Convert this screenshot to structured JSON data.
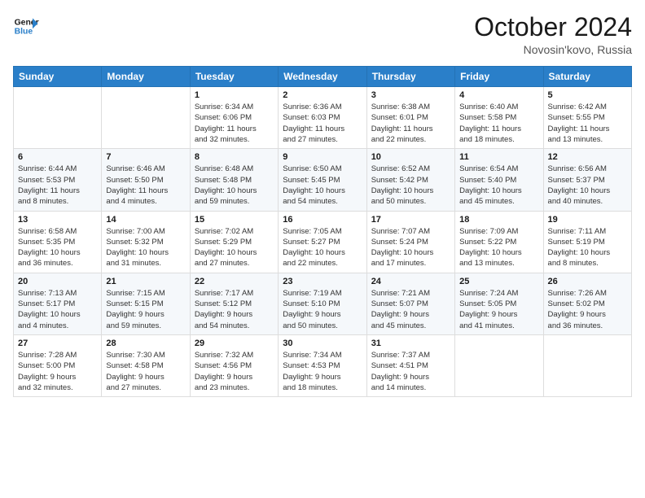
{
  "header": {
    "logo_line1": "General",
    "logo_line2": "Blue",
    "month": "October 2024",
    "location": "Novosin'kovo, Russia"
  },
  "weekdays": [
    "Sunday",
    "Monday",
    "Tuesday",
    "Wednesday",
    "Thursday",
    "Friday",
    "Saturday"
  ],
  "weeks": [
    [
      {
        "day": "",
        "info": ""
      },
      {
        "day": "",
        "info": ""
      },
      {
        "day": "1",
        "info": "Sunrise: 6:34 AM\nSunset: 6:06 PM\nDaylight: 11 hours\nand 32 minutes."
      },
      {
        "day": "2",
        "info": "Sunrise: 6:36 AM\nSunset: 6:03 PM\nDaylight: 11 hours\nand 27 minutes."
      },
      {
        "day": "3",
        "info": "Sunrise: 6:38 AM\nSunset: 6:01 PM\nDaylight: 11 hours\nand 22 minutes."
      },
      {
        "day": "4",
        "info": "Sunrise: 6:40 AM\nSunset: 5:58 PM\nDaylight: 11 hours\nand 18 minutes."
      },
      {
        "day": "5",
        "info": "Sunrise: 6:42 AM\nSunset: 5:55 PM\nDaylight: 11 hours\nand 13 minutes."
      }
    ],
    [
      {
        "day": "6",
        "info": "Sunrise: 6:44 AM\nSunset: 5:53 PM\nDaylight: 11 hours\nand 8 minutes."
      },
      {
        "day": "7",
        "info": "Sunrise: 6:46 AM\nSunset: 5:50 PM\nDaylight: 11 hours\nand 4 minutes."
      },
      {
        "day": "8",
        "info": "Sunrise: 6:48 AM\nSunset: 5:48 PM\nDaylight: 10 hours\nand 59 minutes."
      },
      {
        "day": "9",
        "info": "Sunrise: 6:50 AM\nSunset: 5:45 PM\nDaylight: 10 hours\nand 54 minutes."
      },
      {
        "day": "10",
        "info": "Sunrise: 6:52 AM\nSunset: 5:42 PM\nDaylight: 10 hours\nand 50 minutes."
      },
      {
        "day": "11",
        "info": "Sunrise: 6:54 AM\nSunset: 5:40 PM\nDaylight: 10 hours\nand 45 minutes."
      },
      {
        "day": "12",
        "info": "Sunrise: 6:56 AM\nSunset: 5:37 PM\nDaylight: 10 hours\nand 40 minutes."
      }
    ],
    [
      {
        "day": "13",
        "info": "Sunrise: 6:58 AM\nSunset: 5:35 PM\nDaylight: 10 hours\nand 36 minutes."
      },
      {
        "day": "14",
        "info": "Sunrise: 7:00 AM\nSunset: 5:32 PM\nDaylight: 10 hours\nand 31 minutes."
      },
      {
        "day": "15",
        "info": "Sunrise: 7:02 AM\nSunset: 5:29 PM\nDaylight: 10 hours\nand 27 minutes."
      },
      {
        "day": "16",
        "info": "Sunrise: 7:05 AM\nSunset: 5:27 PM\nDaylight: 10 hours\nand 22 minutes."
      },
      {
        "day": "17",
        "info": "Sunrise: 7:07 AM\nSunset: 5:24 PM\nDaylight: 10 hours\nand 17 minutes."
      },
      {
        "day": "18",
        "info": "Sunrise: 7:09 AM\nSunset: 5:22 PM\nDaylight: 10 hours\nand 13 minutes."
      },
      {
        "day": "19",
        "info": "Sunrise: 7:11 AM\nSunset: 5:19 PM\nDaylight: 10 hours\nand 8 minutes."
      }
    ],
    [
      {
        "day": "20",
        "info": "Sunrise: 7:13 AM\nSunset: 5:17 PM\nDaylight: 10 hours\nand 4 minutes."
      },
      {
        "day": "21",
        "info": "Sunrise: 7:15 AM\nSunset: 5:15 PM\nDaylight: 9 hours\nand 59 minutes."
      },
      {
        "day": "22",
        "info": "Sunrise: 7:17 AM\nSunset: 5:12 PM\nDaylight: 9 hours\nand 54 minutes."
      },
      {
        "day": "23",
        "info": "Sunrise: 7:19 AM\nSunset: 5:10 PM\nDaylight: 9 hours\nand 50 minutes."
      },
      {
        "day": "24",
        "info": "Sunrise: 7:21 AM\nSunset: 5:07 PM\nDaylight: 9 hours\nand 45 minutes."
      },
      {
        "day": "25",
        "info": "Sunrise: 7:24 AM\nSunset: 5:05 PM\nDaylight: 9 hours\nand 41 minutes."
      },
      {
        "day": "26",
        "info": "Sunrise: 7:26 AM\nSunset: 5:02 PM\nDaylight: 9 hours\nand 36 minutes."
      }
    ],
    [
      {
        "day": "27",
        "info": "Sunrise: 7:28 AM\nSunset: 5:00 PM\nDaylight: 9 hours\nand 32 minutes."
      },
      {
        "day": "28",
        "info": "Sunrise: 7:30 AM\nSunset: 4:58 PM\nDaylight: 9 hours\nand 27 minutes."
      },
      {
        "day": "29",
        "info": "Sunrise: 7:32 AM\nSunset: 4:56 PM\nDaylight: 9 hours\nand 23 minutes."
      },
      {
        "day": "30",
        "info": "Sunrise: 7:34 AM\nSunset: 4:53 PM\nDaylight: 9 hours\nand 18 minutes."
      },
      {
        "day": "31",
        "info": "Sunrise: 7:37 AM\nSunset: 4:51 PM\nDaylight: 9 hours\nand 14 minutes."
      },
      {
        "day": "",
        "info": ""
      },
      {
        "day": "",
        "info": ""
      }
    ]
  ]
}
